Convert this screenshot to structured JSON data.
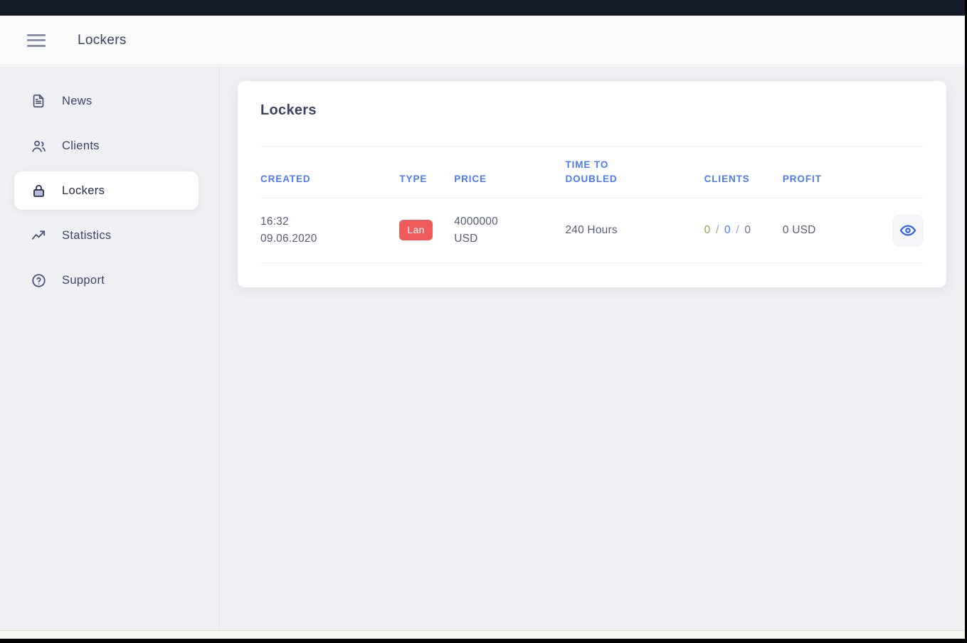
{
  "header": {
    "menu_icon": "hamburger-icon",
    "title": "Lockers"
  },
  "sidebar": {
    "items": [
      {
        "label": "News",
        "icon": "document-icon",
        "active": false
      },
      {
        "label": "Clients",
        "icon": "users-icon",
        "active": false
      },
      {
        "label": "Lockers",
        "icon": "lock-icon",
        "active": true
      },
      {
        "label": "Statistics",
        "icon": "trending-up-icon",
        "active": false
      },
      {
        "label": "Support",
        "icon": "question-circle-icon",
        "active": false
      }
    ]
  },
  "card": {
    "title": "Lockers",
    "columns": [
      "CREATED",
      "TYPE",
      "PRICE",
      "TIME TO DOUBLED",
      "CLIENTS",
      "PROFIT",
      ""
    ],
    "columns_split": {
      "doubled_line1": "TIME TO",
      "doubled_line2": "DOUBLED"
    },
    "rows": [
      {
        "created_time": "16:32",
        "created_date": "09.06.2020",
        "type": "Lan",
        "type_color": "#ef5a5a",
        "price_amount": "4000000",
        "price_currency": "USD",
        "time_to_doubled": "240 Hours",
        "clients": {
          "first": "0",
          "second": "0",
          "third": "0",
          "separator": "/"
        },
        "profit": "0 USD",
        "action_icon": "eye-icon"
      }
    ]
  },
  "colors": {
    "accent": "#4b7bf5",
    "badge_red": "#ef5a5a",
    "clients_green": "#7cb342",
    "clients_blue": "#4b7bf5",
    "clients_gray": "#6b7186",
    "page_bg": "#eff0f3",
    "top_bar": "#141a28"
  }
}
